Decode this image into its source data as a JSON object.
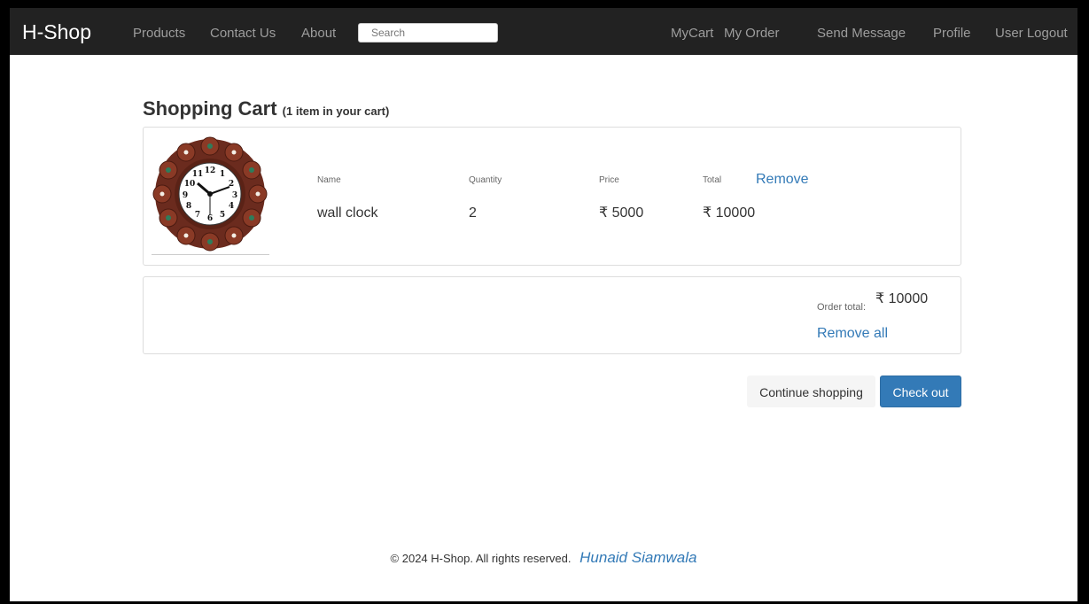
{
  "navbar": {
    "brand": "H-Shop",
    "left_links": [
      "Products",
      "Contact Us",
      "About"
    ],
    "search_placeholder": "Search",
    "right_links": [
      "MyCart",
      "My Order",
      "Send Message",
      "Profile",
      "User Logout"
    ]
  },
  "cart": {
    "title": "Shopping Cart",
    "subtitle": "(1 item in your cart)",
    "columns": {
      "name": "Name",
      "quantity": "Quantity",
      "price": "Price",
      "total": "Total"
    },
    "items": [
      {
        "name": "wall clock",
        "quantity": "2",
        "price": "₹ 5000",
        "total": "₹ 10000",
        "remove_label": "Remove"
      }
    ]
  },
  "summary": {
    "order_total_label": "Order total:",
    "order_total_value": "₹ 10000",
    "remove_all_label": "Remove all"
  },
  "actions": {
    "continue_label": "Continue shopping",
    "checkout_label": "Check out"
  },
  "footer": {
    "copyright": "© 2024 H-Shop. All rights reserved.",
    "author": "Hunaid Siamwala"
  },
  "colors": {
    "navbar_bg": "#222222",
    "link_blue": "#337ab7",
    "checkout_bg": "#337ab7"
  },
  "icons": {
    "product_image": "wall-clock-image"
  }
}
